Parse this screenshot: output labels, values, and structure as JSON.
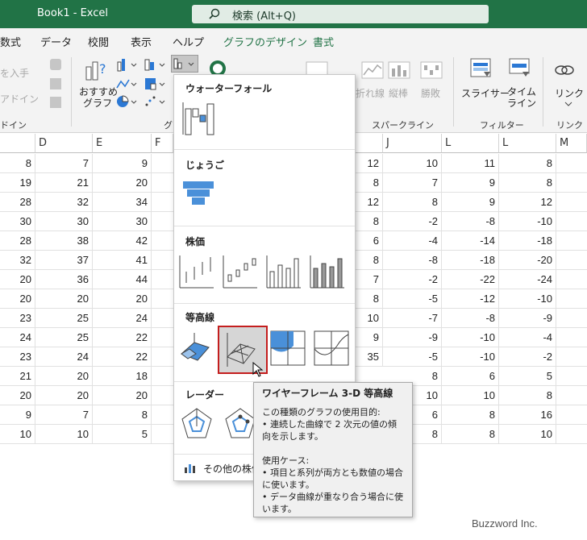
{
  "titlebar": {
    "title": "Book1  -  Excel",
    "search_placeholder": "検索 (Alt+Q)"
  },
  "tabs": [
    "数式",
    "データ",
    "校閲",
    "表示",
    "ヘルプ",
    "グラフのデザイン",
    "書式"
  ],
  "ribbon": {
    "partial_left": [
      "を入手",
      "アドイン"
    ],
    "partial_group": "ドイン",
    "recommended": "おすすめ\nグラフ",
    "group_g": "グ",
    "sparkline_items": [
      "折れ線",
      "縦棒",
      "勝敗"
    ],
    "sparkline_group": "スパークライン",
    "slicer": "スライサー",
    "timeline": "タイム\nライン",
    "filter_group": "フィルター",
    "link": "リンク",
    "link_group": "リンク"
  },
  "menu": {
    "sections": [
      "ウォーターフォール",
      "じょうご",
      "株価",
      "等高線",
      "レーダー"
    ],
    "more": "その他の株価"
  },
  "tooltip": {
    "title": "ワイヤーフレーム 3-D 等高線",
    "lines": [
      "この種類のグラフの使用目的:",
      "• 連続した曲線で 2 次元の値の傾向を示します。",
      "",
      "使用ケース:",
      "• 項目と系列が両方とも数値の場合に使います。",
      "• データ曲線が重なり合う場合に使います。"
    ]
  },
  "grid": {
    "left_headers": [
      "D",
      "E",
      "F"
    ],
    "right_headers": [
      "J",
      "L",
      "L",
      "M"
    ],
    "left_rows": [
      [
        8,
        7,
        9
      ],
      [
        19,
        21,
        20
      ],
      [
        28,
        32,
        34
      ],
      [
        30,
        30,
        30
      ],
      [
        28,
        38,
        42
      ],
      [
        32,
        37,
        41
      ],
      [
        20,
        36,
        44
      ],
      [
        20,
        20,
        20
      ],
      [
        23,
        25,
        24
      ],
      [
        24,
        25,
        22
      ],
      [
        23,
        24,
        22
      ],
      [
        21,
        20,
        18
      ],
      [
        20,
        20,
        20
      ],
      [
        9,
        7,
        8
      ],
      [
        10,
        10,
        5
      ]
    ],
    "right_rows": [
      [
        12,
        10,
        11,
        8
      ],
      [
        8,
        7,
        9,
        8
      ],
      [
        12,
        8,
        9,
        12
      ],
      [
        8,
        -2,
        -8,
        -10
      ],
      [
        6,
        -4,
        -14,
        -18
      ],
      [
        8,
        -8,
        -18,
        -20
      ],
      [
        7,
        -2,
        -22,
        -24
      ],
      [
        8,
        -5,
        -12,
        -10
      ],
      [
        10,
        -7,
        -8,
        -9
      ],
      [
        9,
        -9,
        -10,
        -4
      ],
      [
        35,
        -5,
        -10,
        -2
      ],
      [
        8,
        6,
        5
      ],
      [
        10,
        10,
        8
      ],
      [
        6,
        8,
        16
      ],
      [
        8,
        8,
        10
      ]
    ]
  },
  "credit": "Buzzword Inc."
}
